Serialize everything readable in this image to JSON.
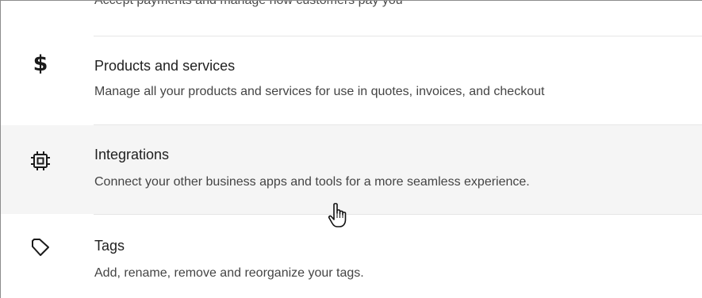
{
  "top_clipped_text": "Accept payments and manage how customers pay you",
  "items": [
    {
      "icon": "dollar-icon",
      "title": "Products and services",
      "description": "Manage all your products and services for use in quotes, invoices, and checkout"
    },
    {
      "icon": "chip-icon",
      "title": "Integrations",
      "description": "Connect your other business apps and tools for a more seamless experience."
    },
    {
      "icon": "tag-icon",
      "title": "Tags",
      "description": "Add, rename, remove and reorganize your tags."
    }
  ],
  "colors": {
    "hover_background": "#f5f5f5",
    "divider": "#e6e6e6",
    "title_text": "#1f1f1f",
    "description_text": "#444444"
  },
  "cursor": "hand-pointer-icon"
}
